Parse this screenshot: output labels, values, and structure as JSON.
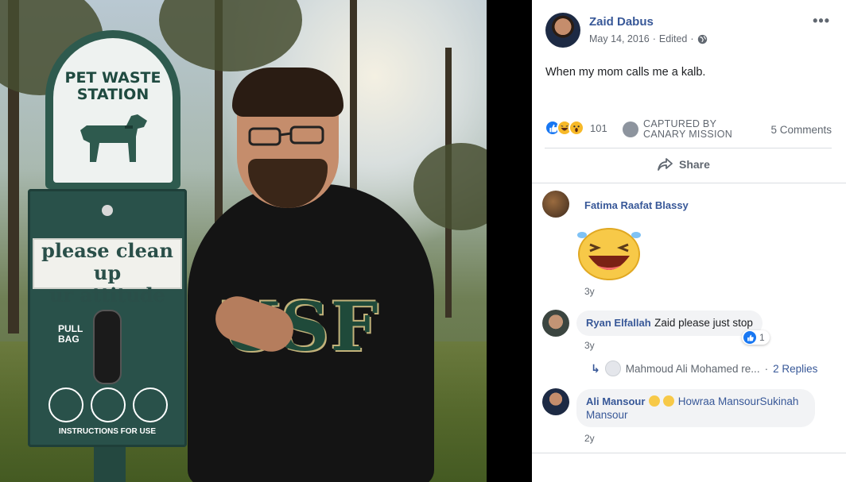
{
  "photo": {
    "sign_title": "PET WASTE\nSTATION",
    "label_line1": "please clean up",
    "label_line2": "ur attitude",
    "pull_text": "PULL\nBAG",
    "instructions": "INSTRUCTIONS FOR USE",
    "shirt_text": "USF"
  },
  "post": {
    "author": "Zaid Dabus",
    "date": "May 14, 2016",
    "edited": "Edited",
    "privacy_icon": "globe-icon",
    "more_icon": "more-options-icon",
    "text": "When my mom calls me a kalb.",
    "reaction_icons": [
      "like",
      "haha",
      "wow"
    ],
    "reaction_count": "101",
    "captured_line1": "CAPTURED BY",
    "captured_line2": "CANARY MISSION",
    "comments_count": "5 Comments",
    "share_label": "Share"
  },
  "comments": [
    {
      "name": "Fatima Raafat Blassy",
      "sticker": "laughing-emoji-sticker",
      "time": "3y"
    },
    {
      "name": "Ryan Elfallah",
      "text": "Zaid please just stop",
      "time": "3y",
      "likes": "1",
      "reply": {
        "name": "Mahmoud Ali Mohamed re...",
        "count": "2 Replies"
      }
    },
    {
      "name": "Ali Mansour",
      "text": "Howraa MansourSukinah Mansour",
      "time": "2y"
    }
  ],
  "colors": {
    "link": "#385898",
    "like_blue": "#1877f2",
    "haha_yellow": "#f7b928"
  }
}
